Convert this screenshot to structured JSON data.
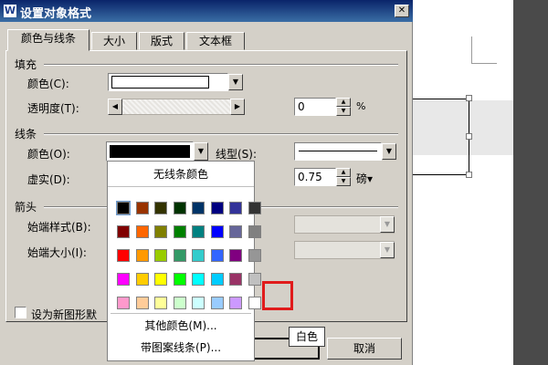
{
  "window": {
    "title": "设置对象格式",
    "app_icon": "W",
    "close_label": "✕"
  },
  "tabs": [
    {
      "label": "颜色与线条",
      "active": true
    },
    {
      "label": "大小",
      "active": false
    },
    {
      "label": "版式",
      "active": false
    },
    {
      "label": "文本框",
      "active": false
    }
  ],
  "fill": {
    "group_label": "填充",
    "color_label": "颜色(C):",
    "transparency_label": "透明度(T):",
    "transparency_value": "0",
    "transparency_unit": "%"
  },
  "line": {
    "group_label": "线条",
    "color_label": "颜色(O):",
    "style_label": "线型(S):",
    "dash_label": "虚实(D):",
    "weight_value": "0.75",
    "weight_unit": "磅▾"
  },
  "arrow": {
    "group_label": "箭头",
    "begin_style_label": "始端样式(B):",
    "begin_size_label": "始端大小(I):"
  },
  "default_checkbox": {
    "label": "设为新图形默"
  },
  "color_popup": {
    "no_line_label": "无线条颜色",
    "more_colors_label": "其他颜色(M)...",
    "pattern_line_label": "带图案线条(P)...",
    "colors": [
      [
        "#000000",
        "#993300",
        "#333300",
        "#003300",
        "#003366",
        "#000080",
        "#333399",
        "#333333"
      ],
      [
        "#800000",
        "#ff6600",
        "#808000",
        "#008000",
        "#008080",
        "#0000ff",
        "#666699",
        "#808080"
      ],
      [
        "#ff0000",
        "#ff9900",
        "#99cc00",
        "#339966",
        "#33cccc",
        "#3366ff",
        "#800080",
        "#969696"
      ],
      [
        "#ff00ff",
        "#ffcc00",
        "#ffff00",
        "#00ff00",
        "#00ffff",
        "#00ccff",
        "#993366",
        "#c0c0c0"
      ],
      [
        "#ff99cc",
        "#ffcc99",
        "#ffff99",
        "#ccffcc",
        "#ccffff",
        "#99ccff",
        "#cc99ff",
        "#ffffff"
      ]
    ],
    "tooltip": "白色"
  },
  "buttons": {
    "ok_label": "",
    "cancel_label": "取消"
  },
  "icons": {
    "dropdown": "▼",
    "spin_up": "▲",
    "spin_down": "▼",
    "scroll_left": "◀",
    "scroll_right": "▶"
  }
}
